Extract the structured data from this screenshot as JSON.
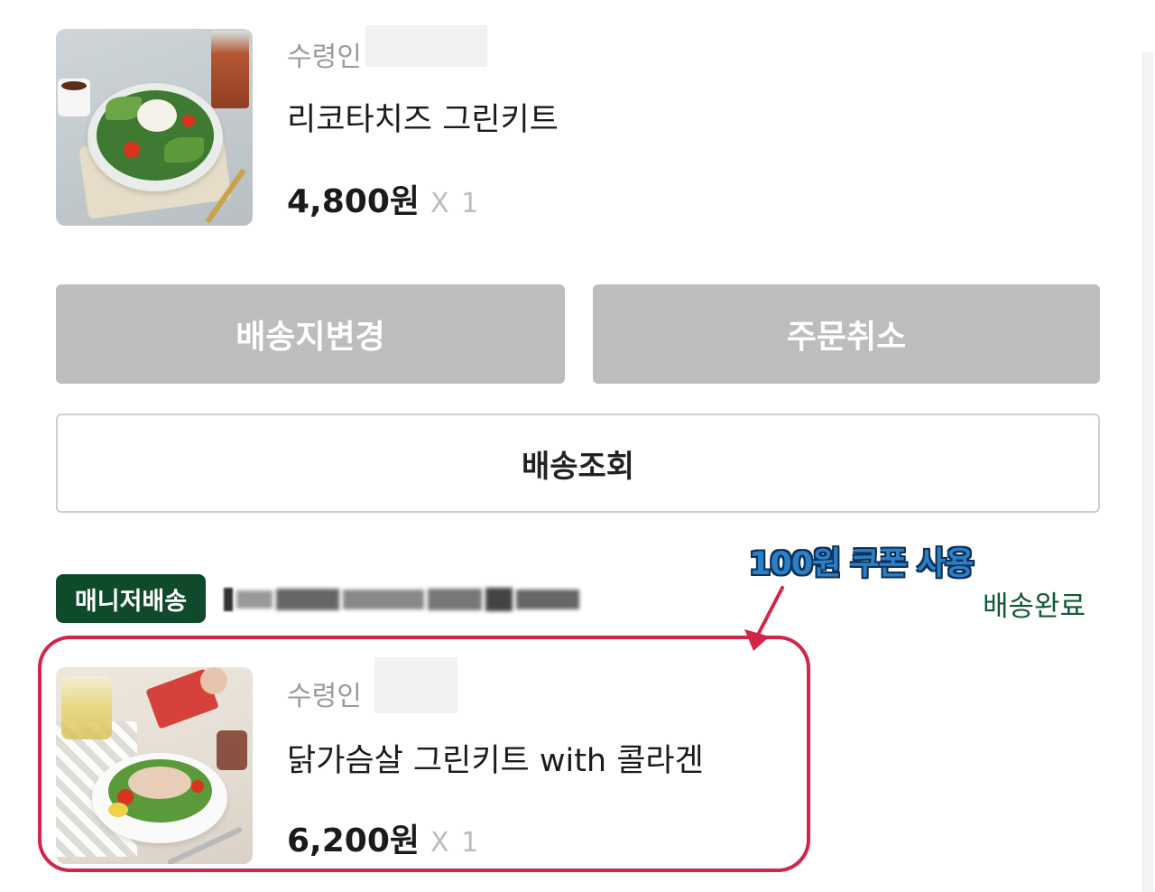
{
  "orders": [
    {
      "recipient_label": "수령인",
      "product_name": "리코타치즈 그린키트",
      "price": "4,800원",
      "quantity": "X 1"
    },
    {
      "recipient_label": "수령인",
      "product_name": "닭가슴살 그린키트 with 콜라겐",
      "price": "6,200원",
      "quantity": "X 1"
    }
  ],
  "actions": {
    "change_address": "배송지변경",
    "cancel_order": "주문취소",
    "track_delivery": "배송조회"
  },
  "delivery": {
    "type_badge": "매니저배송",
    "status": "배송완료"
  },
  "annotation": {
    "text": "100원 쿠폰 사용",
    "color": "#d1264a"
  },
  "colors": {
    "badge_bg": "#0f4a2b",
    "status_text": "#0f5a34",
    "disabled_button": "#bdbdbd",
    "annotation_text": "#2a7fc6"
  }
}
